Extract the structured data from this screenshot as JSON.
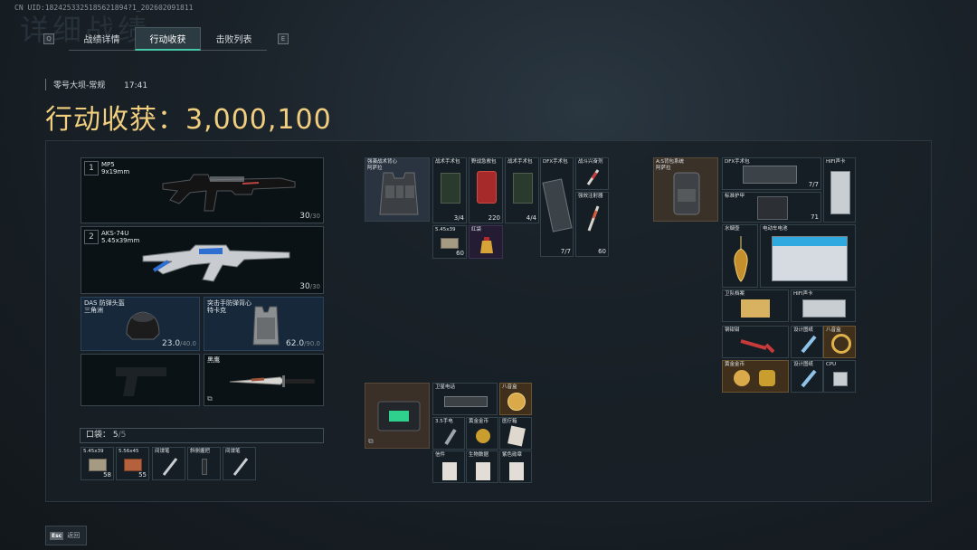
{
  "uid": "CN UID:1824253325185621894?1_2026020​91811",
  "bg_title": "详细战绩",
  "tabs": {
    "left_key": "Q",
    "right_key": "E",
    "items": [
      "战绩详情",
      "行动收获",
      "击败列表"
    ],
    "active": 1
  },
  "meta": {
    "map": "零号大坝-常规",
    "time": "17:41"
  },
  "headline": "行动收获：3,000,100",
  "weapons": [
    {
      "slot": "1",
      "name": "MP5",
      "caliber": "9x19mm",
      "durability": "30",
      "max": "/30"
    },
    {
      "slot": "2",
      "name": "AKS-74U",
      "caliber": "5.45x39mm",
      "durability": "30",
      "max": "/30"
    }
  ],
  "armor": [
    {
      "name": "DAS 防弹头盔",
      "sub": "三角洲",
      "durability": "23.0",
      "max": "/40.0"
    },
    {
      "name": "突击手防弹背心",
      "sub": "特卡克",
      "durability": "62.0",
      "max": "/90.0"
    }
  ],
  "melee": {
    "name": "黑鹰"
  },
  "pocket": {
    "label": "口袋：",
    "count": "5",
    "max": "/5"
  },
  "pocket_items": [
    {
      "label": "5.45x39",
      "count": "58"
    },
    {
      "label": "5.56x45",
      "count": "55"
    },
    {
      "label": "间谍笔",
      "count": ""
    },
    {
      "label": "斜侧握把",
      "count": ""
    },
    {
      "label": "间谍笔",
      "count": ""
    }
  ],
  "chest": {
    "label": "强袭战术背心",
    "sub": "阿萨拉"
  },
  "chest_items": [
    {
      "label": "战术手术包",
      "count": "3/4"
    },
    {
      "label": "野战急救包",
      "count": "220"
    },
    {
      "label": "战术手术包",
      "count": "4/4"
    },
    {
      "label": "DFX手术包",
      "count": "7/7"
    },
    {
      "label": "战斗兴奋剂",
      "count": ""
    },
    {
      "label": "强效注射器",
      "count": "60"
    },
    {
      "label": "5.45x39",
      "count": "60"
    },
    {
      "label": "红袋",
      "count": ""
    }
  ],
  "backpack": {
    "label": "A:S背包系统",
    "sub": "阿萨拉"
  },
  "backpack_items": [
    {
      "label": "DFX手术包",
      "count": "7/7"
    },
    {
      "label": "HIFI声卡",
      "count": ""
    },
    {
      "label": "标准护甲",
      "count": "71"
    },
    {
      "label": "水烟壶",
      "count": ""
    },
    {
      "label": "电动车电池",
      "count": ""
    },
    {
      "label": "卫队档案",
      "count": ""
    },
    {
      "label": "HIFI声卡",
      "count": ""
    },
    {
      "label": "钢钳钳",
      "count": ""
    },
    {
      "label": "设计图纸",
      "count": ""
    },
    {
      "label": "八音盒",
      "count": ""
    },
    {
      "label": "黄金金币",
      "count": ""
    },
    {
      "label": "设计图纸",
      "count": ""
    },
    {
      "label": "CPU",
      "count": ""
    }
  ],
  "case_items": [
    {
      "label": "卫星电话",
      "count": ""
    },
    {
      "label": "八音盒",
      "count": ""
    },
    {
      "label": "3.5手电",
      "count": ""
    },
    {
      "label": "黄金金币",
      "count": ""
    },
    {
      "label": "医疗箱",
      "count": ""
    },
    {
      "label": "信件",
      "count": ""
    },
    {
      "label": "生物数据",
      "count": ""
    },
    {
      "label": "紫色勋章",
      "count": ""
    }
  ],
  "footer": {
    "key": "Esc",
    "label": "返回"
  }
}
